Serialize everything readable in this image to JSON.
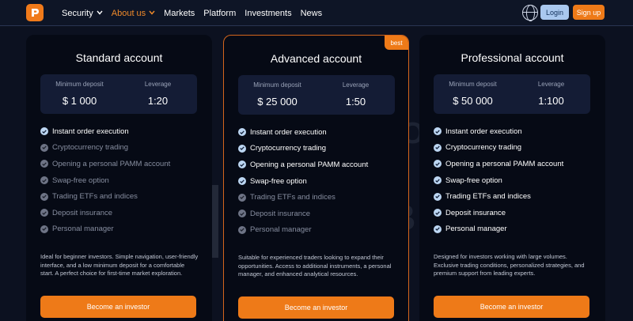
{
  "header": {
    "nav": [
      {
        "label": "Security",
        "has_dropdown": true,
        "active": false
      },
      {
        "label": "About us",
        "has_dropdown": true,
        "active": true
      },
      {
        "label": "Markets",
        "has_dropdown": false,
        "active": false
      },
      {
        "label": "Platform",
        "has_dropdown": false,
        "active": false
      },
      {
        "label": "Investments",
        "has_dropdown": false,
        "active": false
      },
      {
        "label": "News",
        "has_dropdown": false,
        "active": false
      }
    ],
    "login_label": "Login",
    "signup_label": "Sign up",
    "logo_icon": "logo-icon",
    "language_icon": "globe-icon"
  },
  "watermark": {
    "line1": "BROKER",
    "line2": "TRIBUNAL"
  },
  "colors": {
    "accent": "#ee7a18",
    "background": "#0c1120",
    "card": "#060a15",
    "stats_panel": "#141c35",
    "login_button": "#a9c8ef"
  },
  "plans": [
    {
      "title": "Standard account",
      "badge": "",
      "min_deposit_label": "Minimum deposit",
      "min_deposit": "$ 1 000",
      "leverage_label": "Leverage",
      "leverage": "1:20",
      "features": [
        {
          "label": "Instant order execution",
          "included": true
        },
        {
          "label": "Cryptocurrency trading",
          "included": false
        },
        {
          "label": "Opening a personal PAMM account",
          "included": false
        },
        {
          "label": "Swap-free option",
          "included": false
        },
        {
          "label": "Trading ETFs and indices",
          "included": false
        },
        {
          "label": "Deposit insurance",
          "included": false
        },
        {
          "label": "Personal manager",
          "included": false
        }
      ],
      "description": "Ideal for beginner investors. Simple navigation, user-friendly interface, and a low minimum deposit for a comfortable start. A perfect choice for first-time market exploration.",
      "cta": "Become an investor"
    },
    {
      "title": "Advanced account",
      "badge": "best",
      "min_deposit_label": "Minimum deposit",
      "min_deposit": "$ 25 000",
      "leverage_label": "Leverage",
      "leverage": "1:50",
      "features": [
        {
          "label": "Instant order execution",
          "included": true
        },
        {
          "label": "Cryptocurrency trading",
          "included": true
        },
        {
          "label": "Opening a personal PAMM account",
          "included": true
        },
        {
          "label": "Swap-free option",
          "included": true
        },
        {
          "label": "Trading ETFs and indices",
          "included": false
        },
        {
          "label": "Deposit insurance",
          "included": false
        },
        {
          "label": "Personal manager",
          "included": false
        }
      ],
      "description": "Suitable for experienced traders looking to expand their opportunities. Access to additional instruments, a personal manager, and enhanced analytical resources.",
      "cta": "Become an investor"
    },
    {
      "title": "Professional account",
      "badge": "",
      "min_deposit_label": "Minimum deposit",
      "min_deposit": "$ 50 000",
      "leverage_label": "Leverage",
      "leverage": "1:100",
      "features": [
        {
          "label": "Instant order execution",
          "included": true
        },
        {
          "label": "Cryptocurrency trading",
          "included": true
        },
        {
          "label": "Opening a personal PAMM account",
          "included": true
        },
        {
          "label": "Swap-free option",
          "included": true
        },
        {
          "label": "Trading ETFs and indices",
          "included": true
        },
        {
          "label": "Deposit insurance",
          "included": true
        },
        {
          "label": "Personal manager",
          "included": true
        }
      ],
      "description": "Designed for investors working with large volumes. Exclusive trading conditions, personalized strategies, and premium support from leading experts.",
      "cta": "Become an investor"
    }
  ]
}
